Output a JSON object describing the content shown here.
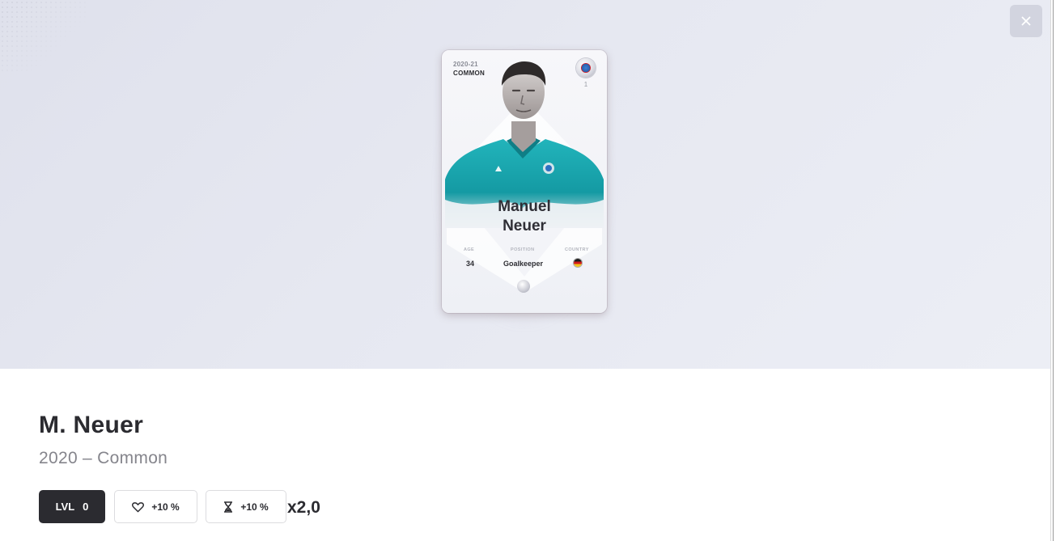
{
  "dialog": {
    "close_icon": "close-icon"
  },
  "card": {
    "season": "2020-21",
    "rarity": "COMMON",
    "club_badge_icon": "club-crest-icon",
    "serial": "1",
    "first_name": "Manuel",
    "last_name": "Neuer",
    "stats": [
      {
        "label": "AGE",
        "value": "34"
      },
      {
        "label": "POSITION",
        "value": "Goalkeeper"
      },
      {
        "label": "COUNTRY",
        "value": "",
        "icon": "germany-flag-icon"
      }
    ],
    "jersey_color": "#1aa3ab"
  },
  "player": {
    "title": "M. Neuer",
    "subtitle": "2020 – Common"
  },
  "badges": {
    "level_label": "LVL",
    "level_value": "0",
    "likes_bonus": "+10 %",
    "time_bonus": "+10 %",
    "multiplier": "x2,0"
  },
  "colors": {
    "dark": "#2b2b30",
    "muted": "#85858c",
    "hero_bg": "#e3e5ef"
  }
}
